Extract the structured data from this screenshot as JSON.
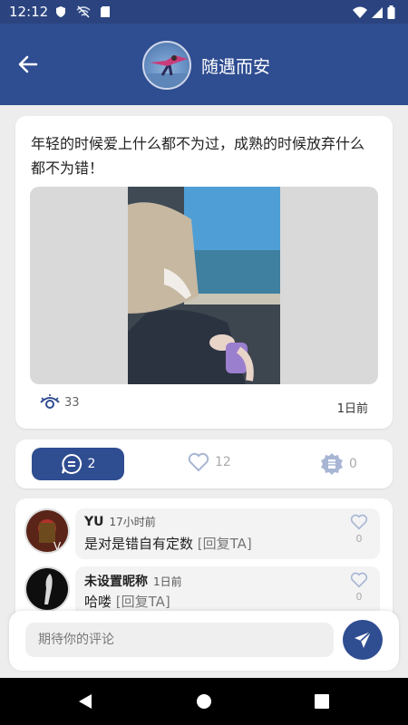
{
  "status_bar": {
    "time": "12:12"
  },
  "header": {
    "title": "随遇而安"
  },
  "post": {
    "text": "年轻的时候爱上什么都不为过，成熟的时候放弃什么都不为错！",
    "views": "33",
    "time": "1日前"
  },
  "actions": {
    "comment_count": "2",
    "like_count": "12",
    "award_count": "0"
  },
  "comments": [
    {
      "name": "YU",
      "time": "17小时前",
      "body": "是对是错自有定数",
      "reply": "[回复TA]",
      "likes": "0"
    },
    {
      "name": "未设置昵称",
      "time": "1日前",
      "body": "哈喽",
      "reply": "[回复TA]",
      "likes": "0"
    }
  ],
  "input": {
    "placeholder": "期待你的评论"
  },
  "colors": {
    "primary": "#2f4d91",
    "statusbar": "#2b4480",
    "background": "#ededed"
  }
}
